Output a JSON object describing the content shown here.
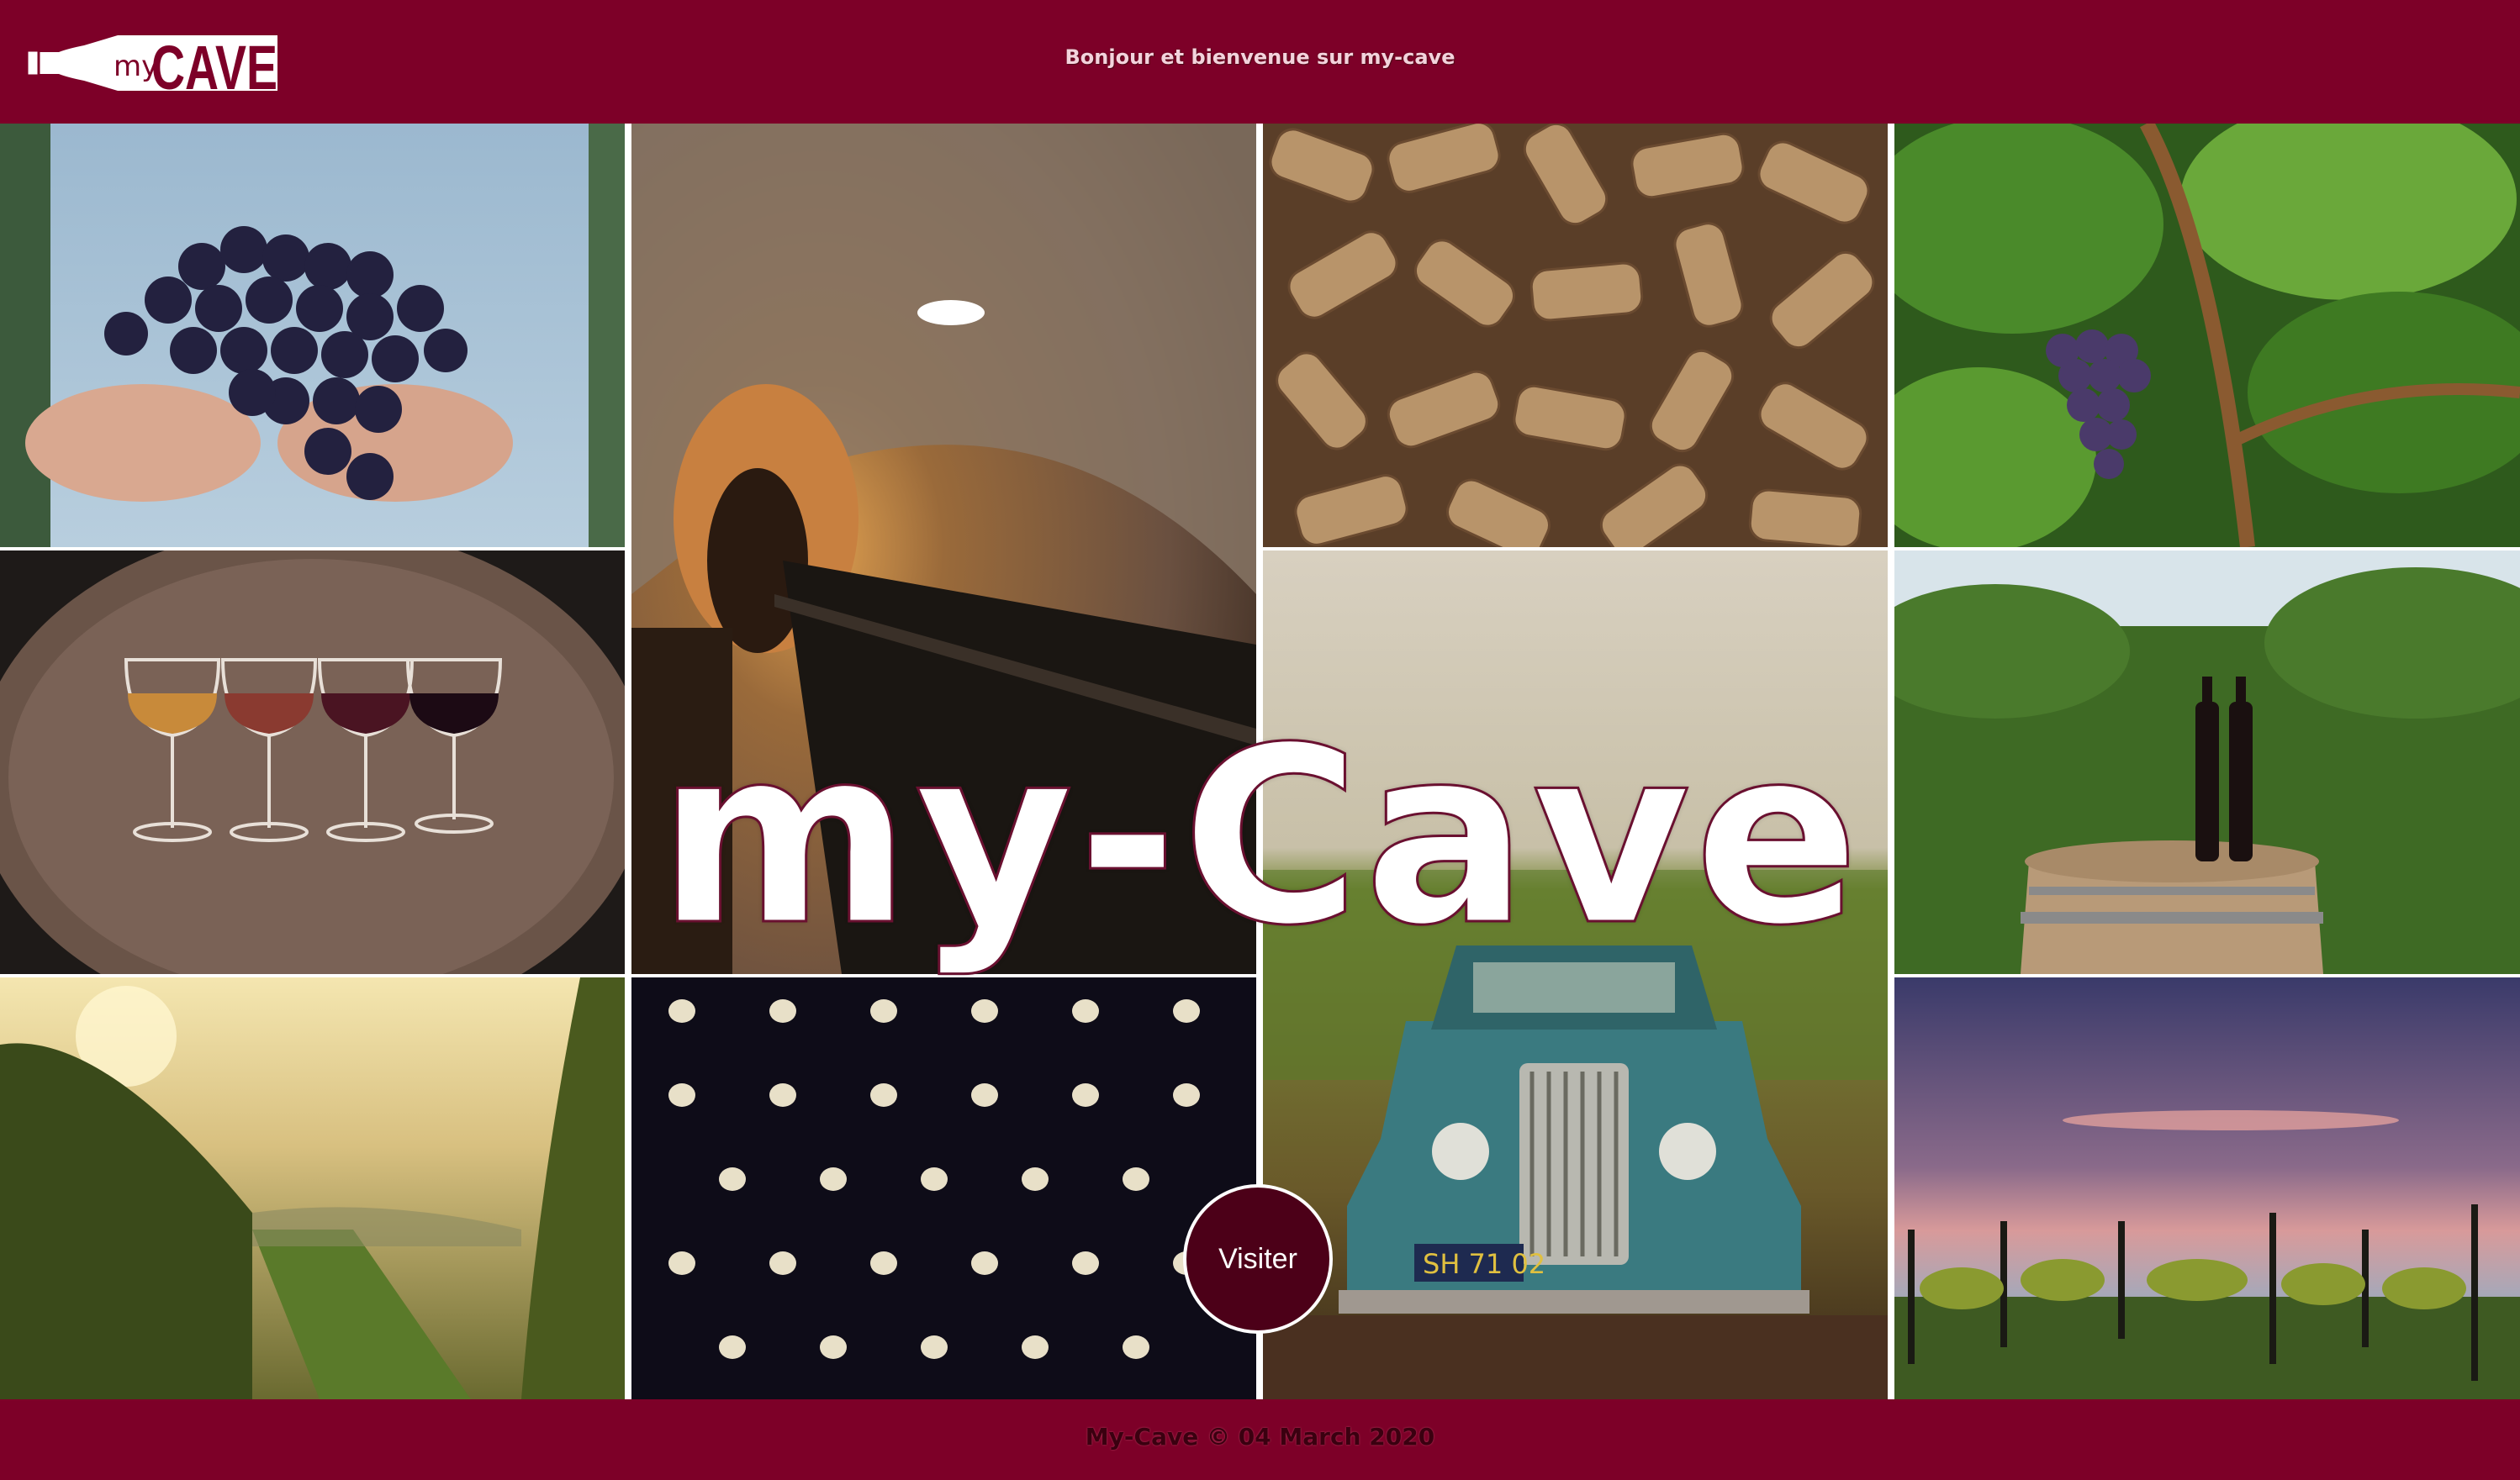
{
  "header": {
    "logo_small": "my",
    "logo_big": "CAVE",
    "welcome_text": "Bonjour et bienvenue sur my-cave"
  },
  "hero": {
    "title": "my-Cave",
    "visit_label": "Visiter"
  },
  "gallery": {
    "photos": [
      "hands-holding-grapes",
      "wine-cellar-tunnel",
      "wine-corks",
      "grapes-on-vine",
      "wine-glasses-on-barrel",
      "vintage-truck-in-vineyard",
      "bottles-on-barrel-vineyard",
      "vineyard-sunset-rows",
      "stacked-wine-bottles",
      "vineyard-dusk-sky"
    ]
  },
  "footer": {
    "copyright": "My-Cave © 04 March 2020"
  },
  "colors": {
    "brand": "#7d0028",
    "button": "#4c0018"
  }
}
